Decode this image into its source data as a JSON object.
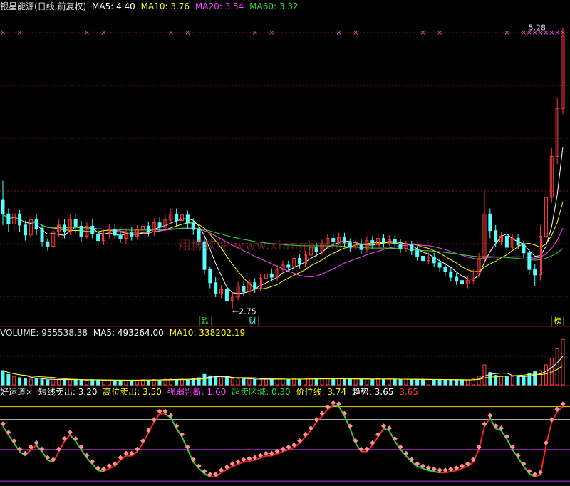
{
  "colors": {
    "up": "#ff3c3c",
    "down": "#54ffff",
    "ma5": "#ffffff",
    "ma10": "#ffff00",
    "ma20": "#ff44ff",
    "ma60": "#33dd33",
    "grid": "#9a1818",
    "cross": "#ff44ff",
    "trend_up": "#ff2020",
    "trend_down": "#33cc33",
    "dots": "#ff9090",
    "yellow_line": "#e8d020",
    "purple_line": "#b030d0",
    "white_line": "#e0e0e0"
  },
  "header_main": {
    "title": "银星能源(日线,前复权)",
    "ma5_label": "MA5: 4.40",
    "ma10_label": "MA10: 3.76",
    "ma20_label": "MA20: 3.54",
    "ma60_label": "MA60: 3.32"
  },
  "header_volume": {
    "volume_label": "VOLUME: 955538.38",
    "ma5_label": "MA5: 493264.00",
    "ma10_label": "MA10: 338202.19"
  },
  "header_indicator": {
    "name": "好运道×",
    "s1": "短线卖出: 3.20",
    "s2": "高位卖出: 3.50",
    "s3": "强弱判断: 1.60",
    "s4": "超卖区域: 0.30",
    "s5": "价位线: 3.74",
    "s6": "趋势: 3.65",
    "s7": "3.65"
  },
  "annotations": {
    "high_label": "5.28",
    "low_label": "←2.75",
    "watermark": "翔博软件 www.xiangbosoft.com",
    "tag_die": "跌",
    "tag_cai": "财",
    "tag_bang": "榜"
  },
  "chart_data": {
    "type": "candlestick",
    "title": "银星能源(日线,前复权)",
    "price_range": [
      2.6,
      5.4
    ],
    "ohlc": [
      [
        3.73,
        3.6,
        3.9,
        3.5
      ],
      [
        3.6,
        3.51,
        3.65,
        3.44
      ],
      [
        3.51,
        3.6,
        3.66,
        3.45
      ],
      [
        3.6,
        3.5,
        3.64,
        3.44
      ],
      [
        3.5,
        3.41,
        3.54,
        3.36
      ],
      [
        3.41,
        3.55,
        3.59,
        3.36
      ],
      [
        3.55,
        3.47,
        3.6,
        3.41
      ],
      [
        3.47,
        3.35,
        3.5,
        3.31
      ],
      [
        3.35,
        3.31,
        3.38,
        3.27
      ],
      [
        3.31,
        3.44,
        3.48,
        3.29
      ],
      [
        3.44,
        3.5,
        3.55,
        3.39
      ],
      [
        3.5,
        3.44,
        3.55,
        3.38
      ],
      [
        3.44,
        3.55,
        3.6,
        3.41
      ],
      [
        3.55,
        3.49,
        3.6,
        3.43
      ],
      [
        3.49,
        3.4,
        3.54,
        3.35
      ],
      [
        3.4,
        3.49,
        3.53,
        3.37
      ],
      [
        3.49,
        3.42,
        3.55,
        3.38
      ],
      [
        3.42,
        3.36,
        3.47,
        3.31
      ],
      [
        3.36,
        3.42,
        3.46,
        3.32
      ],
      [
        3.42,
        3.46,
        3.51,
        3.38
      ],
      [
        3.46,
        3.41,
        3.51,
        3.37
      ],
      [
        3.41,
        3.38,
        3.45,
        3.34
      ],
      [
        3.38,
        3.43,
        3.47,
        3.33
      ],
      [
        3.43,
        3.4,
        3.48,
        3.36
      ],
      [
        3.4,
        3.46,
        3.5,
        3.37
      ],
      [
        3.46,
        3.49,
        3.54,
        3.42
      ],
      [
        3.49,
        3.44,
        3.53,
        3.4
      ],
      [
        3.44,
        3.52,
        3.56,
        3.4
      ],
      [
        3.52,
        3.48,
        3.57,
        3.44
      ],
      [
        3.48,
        3.55,
        3.59,
        3.45
      ],
      [
        3.55,
        3.6,
        3.65,
        3.51
      ],
      [
        3.6,
        3.54,
        3.65,
        3.49
      ],
      [
        3.54,
        3.59,
        3.63,
        3.5
      ],
      [
        3.59,
        3.52,
        3.63,
        3.47
      ],
      [
        3.52,
        3.46,
        3.56,
        3.41
      ],
      [
        3.46,
        3.35,
        3.5,
        3.31
      ],
      [
        3.35,
        3.1,
        3.38,
        3.05
      ],
      [
        3.1,
        2.98,
        3.13,
        2.93
      ],
      [
        2.98,
        2.88,
        3.03,
        2.85
      ],
      [
        2.88,
        2.92,
        2.96,
        2.84
      ],
      [
        2.92,
        2.82,
        2.95,
        2.77
      ],
      [
        2.82,
        2.85,
        2.89,
        2.75
      ],
      [
        2.85,
        2.95,
        2.99,
        2.82
      ],
      [
        2.95,
        2.9,
        2.99,
        2.86
      ],
      [
        2.9,
        2.98,
        3.02,
        2.87
      ],
      [
        2.98,
        2.93,
        3.02,
        2.89
      ],
      [
        2.93,
        3.02,
        3.06,
        2.9
      ],
      [
        3.02,
        3.06,
        3.1,
        2.98
      ],
      [
        3.06,
        3.03,
        3.11,
        2.99
      ],
      [
        3.03,
        3.1,
        3.14,
        3.0
      ],
      [
        3.1,
        3.14,
        3.18,
        3.06
      ],
      [
        3.14,
        3.12,
        3.18,
        3.08
      ],
      [
        3.12,
        3.2,
        3.24,
        3.09
      ],
      [
        3.2,
        3.15,
        3.24,
        3.11
      ],
      [
        3.15,
        3.23,
        3.27,
        3.12
      ],
      [
        3.23,
        3.3,
        3.34,
        3.2
      ],
      [
        3.3,
        3.26,
        3.34,
        3.22
      ],
      [
        3.26,
        3.33,
        3.37,
        3.23
      ],
      [
        3.33,
        3.38,
        3.42,
        3.29
      ],
      [
        3.38,
        3.35,
        3.42,
        3.31
      ],
      [
        3.35,
        3.39,
        3.43,
        3.32
      ],
      [
        3.39,
        3.34,
        3.43,
        3.3
      ],
      [
        3.34,
        3.3,
        3.38,
        3.26
      ],
      [
        3.3,
        3.33,
        3.37,
        3.27
      ],
      [
        3.33,
        3.28,
        3.37,
        3.24
      ],
      [
        3.28,
        3.36,
        3.4,
        3.25
      ],
      [
        3.36,
        3.32,
        3.4,
        3.28
      ],
      [
        3.32,
        3.38,
        3.42,
        3.29
      ],
      [
        3.38,
        3.34,
        3.42,
        3.3
      ],
      [
        3.34,
        3.37,
        3.41,
        3.31
      ],
      [
        3.37,
        3.33,
        3.41,
        3.29
      ],
      [
        3.33,
        3.29,
        3.37,
        3.25
      ],
      [
        3.29,
        3.32,
        3.36,
        3.26
      ],
      [
        3.32,
        3.27,
        3.36,
        3.23
      ],
      [
        3.27,
        3.22,
        3.31,
        3.18
      ],
      [
        3.22,
        3.18,
        3.26,
        3.14
      ],
      [
        3.18,
        3.21,
        3.25,
        3.15
      ],
      [
        3.21,
        3.16,
        3.25,
        3.12
      ],
      [
        3.16,
        3.12,
        3.2,
        3.08
      ],
      [
        3.12,
        3.08,
        3.16,
        3.04
      ],
      [
        3.08,
        3.03,
        3.12,
        2.99
      ],
      [
        3.03,
        3.0,
        3.07,
        2.96
      ],
      [
        3.0,
        2.97,
        3.04,
        2.93
      ],
      [
        2.97,
        3.0,
        3.04,
        2.93
      ],
      [
        3.0,
        3.06,
        3.1,
        2.97
      ],
      [
        3.06,
        3.2,
        3.25,
        3.03
      ],
      [
        3.2,
        3.6,
        3.8,
        3.15
      ],
      [
        3.6,
        3.45,
        3.65,
        3.38
      ],
      [
        3.45,
        3.35,
        3.5,
        3.3
      ],
      [
        3.35,
        3.4,
        3.44,
        3.32
      ],
      [
        3.4,
        3.3,
        3.44,
        3.26
      ],
      [
        3.3,
        3.38,
        3.42,
        3.28
      ],
      [
        3.38,
        3.32,
        3.42,
        3.28
      ],
      [
        3.32,
        3.25,
        3.36,
        3.2
      ],
      [
        3.25,
        3.1,
        3.28,
        3.05
      ],
      [
        3.1,
        3.05,
        3.15,
        2.95
      ],
      [
        3.05,
        3.4,
        3.5,
        3.0
      ],
      [
        3.4,
        3.75,
        3.9,
        3.35
      ],
      [
        3.75,
        4.12,
        4.2,
        3.7
      ],
      [
        4.12,
        4.55,
        4.65,
        4.05
      ],
      [
        4.55,
        5.2,
        5.28,
        4.5
      ]
    ],
    "volume": {
      "range": [
        0,
        960000
      ],
      "values": [
        300000,
        220000,
        180000,
        150000,
        140000,
        120000,
        130000,
        110000,
        100000,
        120000,
        115000,
        105000,
        112000,
        108000,
        100000,
        95000,
        110000,
        98000,
        90000,
        105000,
        98000,
        94000,
        100000,
        96000,
        102000,
        108000,
        100000,
        112000,
        104000,
        118000,
        122000,
        114000,
        120000,
        112000,
        128000,
        150000,
        220000,
        190000,
        170000,
        140000,
        160000,
        130000,
        125000,
        118000,
        120000,
        115000,
        125000,
        122000,
        118000,
        120000,
        124000,
        118000,
        126000,
        118000,
        128000,
        132000,
        124000,
        130000,
        134000,
        126000,
        128000,
        122000,
        118000,
        124000,
        116000,
        126000,
        120000,
        128000,
        118000,
        124000,
        118000,
        112000,
        116000,
        110000,
        118000,
        114000,
        108000,
        112000,
        106000,
        110000,
        104000,
        100000,
        98000,
        104000,
        130000,
        180000,
        420000,
        260000,
        200000,
        180000,
        170000,
        175000,
        165000,
        180000,
        240000,
        280000,
        300000,
        420000,
        560000,
        760000,
        955538
      ]
    },
    "indicator": {
      "range": [
        0,
        4
      ],
      "levels": {
        "yellow_line": 3.2,
        "white_line": 3.5,
        "purple_line": 1.6,
        "bottom_line": 0.3
      },
      "trend": [
        2.7,
        2.3,
        1.9,
        1.5,
        1.3,
        1.6,
        1.8,
        1.5,
        1.1,
        1.0,
        1.5,
        2.0,
        2.3,
        2.0,
        1.6,
        1.2,
        0.9,
        0.6,
        0.55,
        0.7,
        0.8,
        1.1,
        1.3,
        1.3,
        1.5,
        1.9,
        2.4,
        2.9,
        3.3,
        3.3,
        3.1,
        2.6,
        2.2,
        1.6,
        1.0,
        0.7,
        0.45,
        0.3,
        0.3,
        0.5,
        0.65,
        0.8,
        0.9,
        1.0,
        1.05,
        1.1,
        1.2,
        1.3,
        1.3,
        1.4,
        1.5,
        1.6,
        1.7,
        1.9,
        2.2,
        2.5,
        2.9,
        3.2,
        3.5,
        3.7,
        3.65,
        3.2,
        2.6,
        1.9,
        1.5,
        1.5,
        1.8,
        2.2,
        2.6,
        2.5,
        2.0,
        1.6,
        1.3,
        1.0,
        0.8,
        0.7,
        0.6,
        0.55,
        0.5,
        0.5,
        0.55,
        0.6,
        0.7,
        0.8,
        1.0,
        1.6,
        2.7,
        3.1,
        2.6,
        2.5,
        2.1,
        1.6,
        1.2,
        0.8,
        0.45,
        0.3,
        0.4,
        1.8,
        2.9,
        3.4,
        3.65
      ]
    },
    "markers": {
      "high": 5.28,
      "low": 2.75,
      "last_high_line": 4.9
    }
  }
}
